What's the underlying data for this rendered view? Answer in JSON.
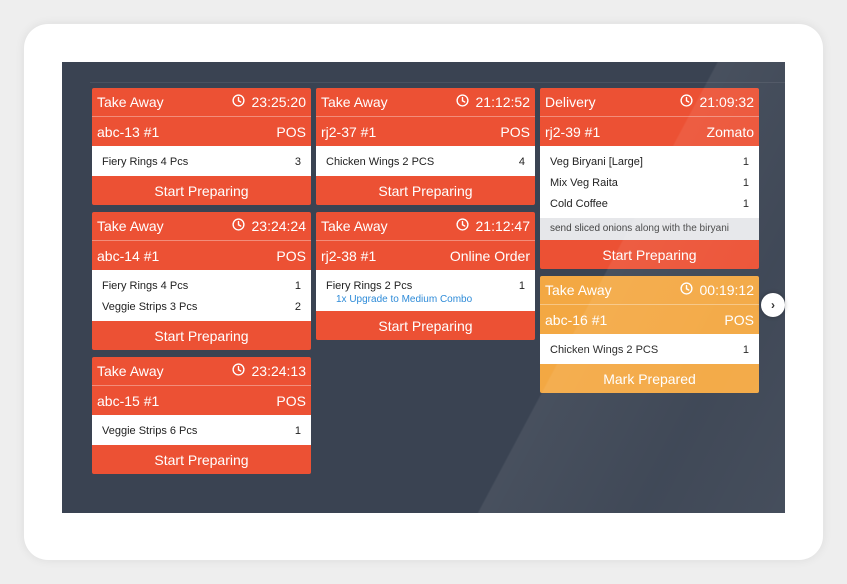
{
  "columns": [
    {
      "cards": [
        {
          "status": "red",
          "type": "Take Away",
          "time": "23:25:20",
          "order": "abc-13 #1",
          "source": "POS",
          "items": [
            {
              "name": "Fiery Rings 4 Pcs",
              "qty": "3"
            }
          ],
          "action": "Start Preparing"
        },
        {
          "status": "red",
          "type": "Take Away",
          "time": "23:24:24",
          "order": "abc-14 #1",
          "source": "POS",
          "items": [
            {
              "name": "Fiery Rings 4 Pcs",
              "qty": "1"
            },
            {
              "name": "Veggie Strips 3 Pcs",
              "qty": "2"
            }
          ],
          "action": "Start Preparing"
        },
        {
          "status": "red",
          "type": "Take Away",
          "time": "23:24:13",
          "order": "abc-15 #1",
          "source": "POS",
          "items": [
            {
              "name": "Veggie Strips 6 Pcs",
              "qty": "1"
            }
          ],
          "action": "Start Preparing"
        }
      ]
    },
    {
      "cards": [
        {
          "status": "red",
          "type": "Take Away",
          "time": "21:12:52",
          "order": "rj2-37 #1",
          "source": "POS",
          "items": [
            {
              "name": "Chicken Wings 2 PCS",
              "qty": "4"
            }
          ],
          "action": "Start Preparing"
        },
        {
          "status": "red",
          "type": "Take Away",
          "time": "21:12:47",
          "order": "rj2-38 #1",
          "source": "Online Order",
          "items": [
            {
              "name": "Fiery Rings 2 Pcs",
              "qty": "1",
              "modifier": "1x Upgrade to Medium Combo"
            }
          ],
          "action": "Start Preparing"
        }
      ]
    },
    {
      "cards": [
        {
          "status": "red",
          "type": "Delivery",
          "time": "21:09:32",
          "order": "rj2-39 #1",
          "source": "Zomato",
          "items": [
            {
              "name": "Veg Biryani [Large]",
              "qty": "1"
            },
            {
              "name": "Mix Veg Raita",
              "qty": "1"
            },
            {
              "name": "Cold Coffee",
              "qty": "1"
            }
          ],
          "note": "send sliced onions along with the biryani",
          "action": "Start Preparing"
        },
        {
          "status": "amber",
          "type": "Take Away",
          "time": "00:19:12",
          "order": "abc-16 #1",
          "source": "POS",
          "items": [
            {
              "name": "Chicken Wings 2 PCS",
              "qty": "1"
            }
          ],
          "action": "Mark Prepared"
        }
      ]
    }
  ],
  "nav": {
    "next_icon": "chevron-right-icon",
    "next_glyph": "›"
  },
  "colors": {
    "order_new": "#ec5134",
    "order_preparing": "#f3a843",
    "screen_bg": "#3a4352"
  }
}
